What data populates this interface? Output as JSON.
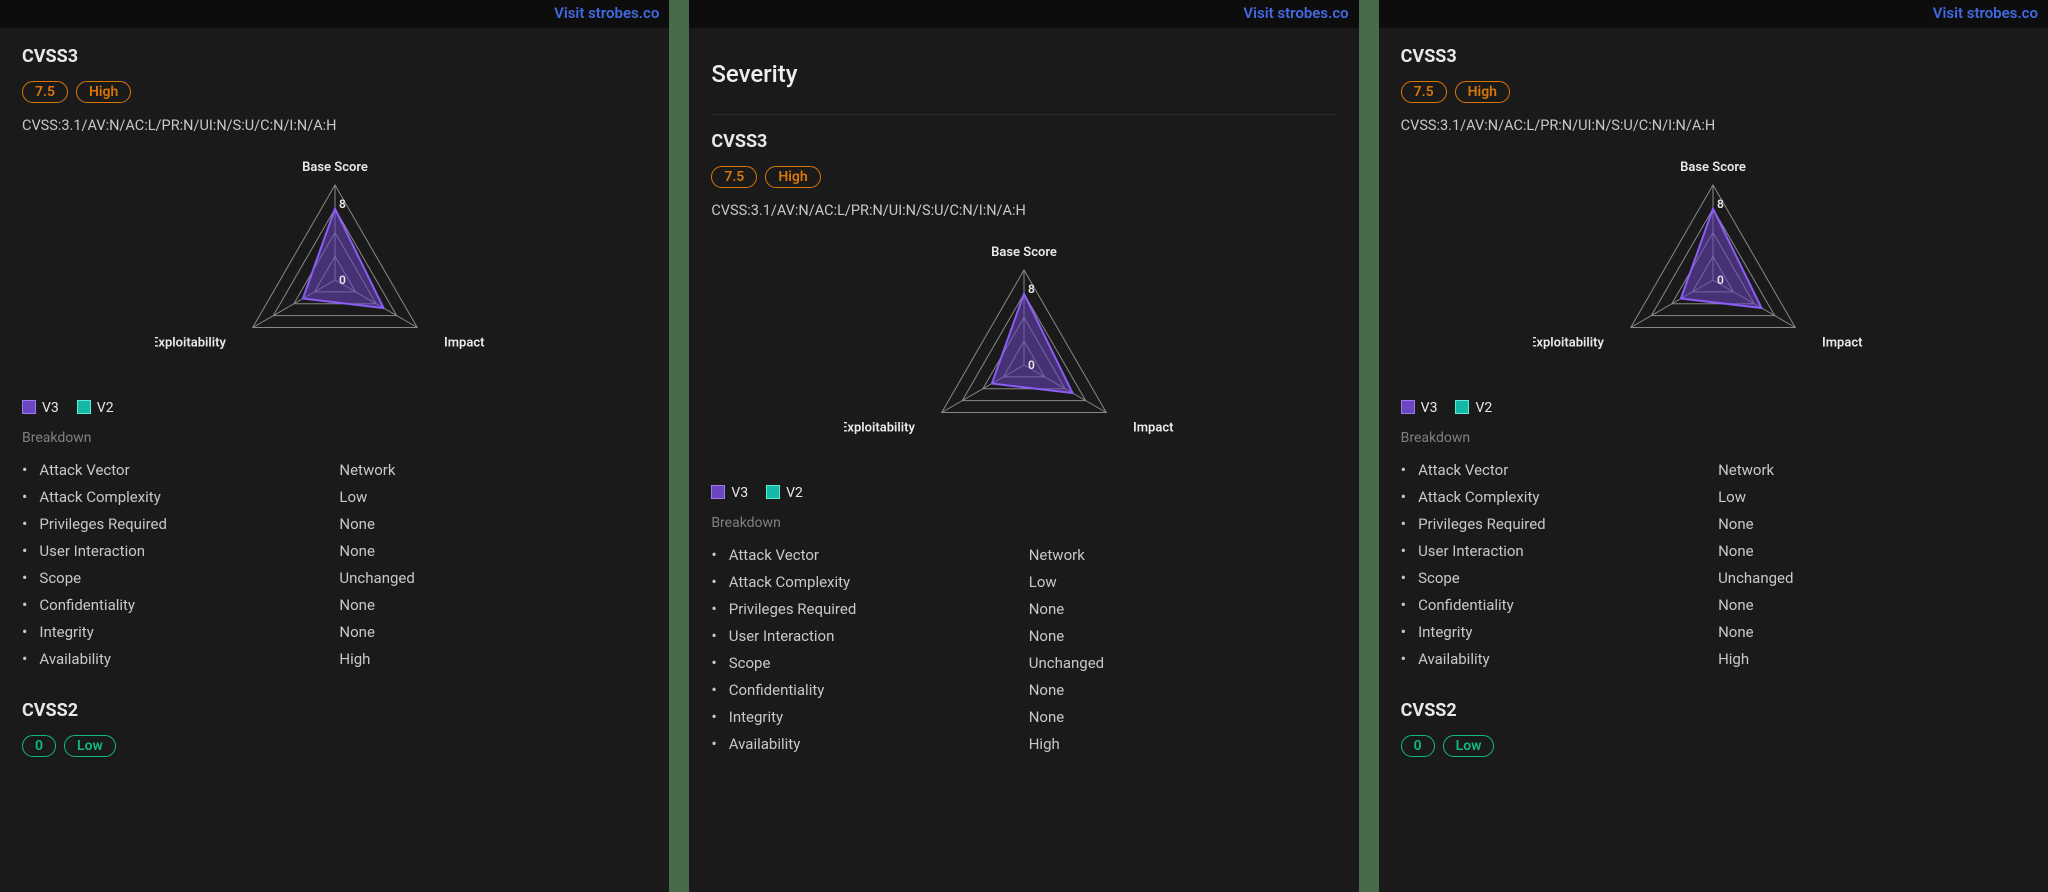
{
  "visit_link": "Visit strobes.co",
  "cvss3": {
    "title": "CVSS3",
    "score": "7.5",
    "severity": "High",
    "vector": "CVSS:3.1/AV:N/AC:L/PR:N/UI:N/S:U/C:N/I:N/A:H"
  },
  "cvss2": {
    "title": "CVSS2",
    "score": "0",
    "severity": "Low"
  },
  "severity_heading": "Severity",
  "legend": {
    "v3": "V3",
    "v2": "V2"
  },
  "breakdown_title": "Breakdown",
  "breakdown": [
    {
      "k": "Attack Vector",
      "v": "Network"
    },
    {
      "k": "Attack Complexity",
      "v": "Low"
    },
    {
      "k": "Privileges Required",
      "v": "None"
    },
    {
      "k": "User Interaction",
      "v": "None"
    },
    {
      "k": "Scope",
      "v": "Unchanged"
    },
    {
      "k": "Confidentiality",
      "v": "None"
    },
    {
      "k": "Integrity",
      "v": "None"
    },
    {
      "k": "Availability",
      "v": "High"
    }
  ],
  "chart_data": {
    "type": "radar",
    "axes": [
      "Base Score",
      "Impact",
      "Exploitability"
    ],
    "ticks": [
      0,
      8
    ],
    "max": 10,
    "series": [
      {
        "name": "V3",
        "color": "#6b46c1",
        "values": [
          7.5,
          5.9,
          3.9
        ]
      },
      {
        "name": "V2",
        "color": "#14b8a6",
        "values": [
          0,
          0,
          0
        ]
      }
    ]
  }
}
